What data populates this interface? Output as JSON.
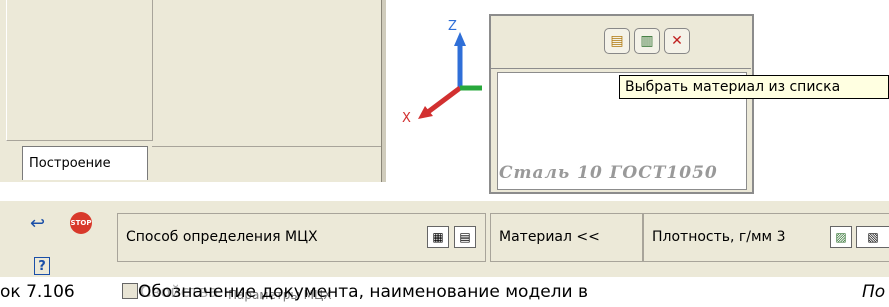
{
  "tree_panel": {
    "tab_label": "Построение"
  },
  "axes": {
    "z_label": "Z",
    "x_label": "X"
  },
  "material_dialog": {
    "material_name": "Сталь 10 ГОСТ1050",
    "tooltip": "Выбрать материал из списка"
  },
  "properties_bar": {
    "mcx_method_label": "Способ определения МЦХ",
    "material_button_label": "Материал <<",
    "density_label": "Плотность, г/мм 3"
  },
  "bottom_text": {
    "caption": "ок 7.106",
    "overlap_back": "Свойства",
    "overlap_front": "Обозначение документа, наименование модели в",
    "overlap_tab": "Параметры МЦХ",
    "right_fragment": "По"
  },
  "colors": {
    "stop": "#d8392b",
    "axis_x": "#d23030",
    "axis_y": "#28a83c",
    "axis_z": "#2f6fd8",
    "tooltip_bg": "#ffffe1"
  }
}
